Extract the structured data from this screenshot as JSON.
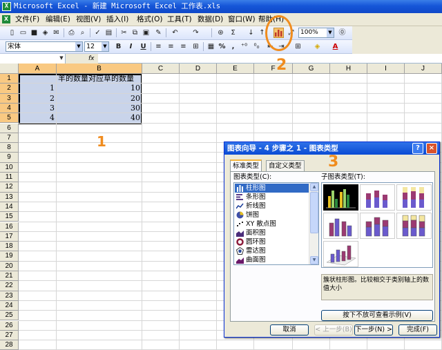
{
  "window": {
    "title": "Microsoft Excel - 新建 Microsoft Excel 工作表.xls",
    "app_icon": "excel-icon"
  },
  "menu": {
    "items": [
      "文件(F)",
      "编辑(E)",
      "视图(V)",
      "插入(I)",
      "格式(O)",
      "工具(T)",
      "数据(D)",
      "窗口(W)",
      "帮助(H)"
    ]
  },
  "toolbar": {
    "zoom": "100%",
    "chart_wizard_icon": "chart-wizard-icon"
  },
  "format_toolbar": {
    "font": "宋体",
    "size": "12",
    "bold": "B",
    "italic": "I",
    "underline": "U",
    "percent": "%",
    "comma": ","
  },
  "formula_bar": {
    "name_box": "",
    "fx": "fx",
    "content": ""
  },
  "sheet": {
    "columns": [
      "A",
      "B",
      "C",
      "D",
      "E",
      "F",
      "G",
      "H",
      "I",
      "J"
    ],
    "rows": [
      "1",
      "2",
      "3",
      "4",
      "5",
      "6",
      "7",
      "8",
      "9",
      "10",
      "11",
      "12",
      "13",
      "14",
      "15",
      "16",
      "17",
      "18",
      "19",
      "20",
      "21",
      "22",
      "23",
      "24",
      "25",
      "26",
      "27",
      "28"
    ],
    "B1": "羊的数量对应草的数量",
    "data": [
      [
        "1",
        "10"
      ],
      [
        "2",
        "20"
      ],
      [
        "3",
        "30"
      ],
      [
        "4",
        "40"
      ]
    ]
  },
  "dialog": {
    "title": "图表向导 - 4 步骤之 1 - 图表类型",
    "tabs": [
      "标准类型",
      "自定义类型"
    ],
    "chart_type_label": "图表类型(C):",
    "subtype_label": "子图表类型(T):",
    "chart_types": [
      "柱形图",
      "条形图",
      "折线图",
      "饼图",
      "XY 散点图",
      "面积图",
      "圆环图",
      "雷达图",
      "曲面图"
    ],
    "description": "簇状柱形图。比较相交于类别轴上的数值大小",
    "preview_button": "按下不放可查看示例(V)",
    "buttons": {
      "cancel": "取消",
      "back": "< 上一步(B)",
      "next": "下一步(N) >",
      "finish": "完成(F)"
    },
    "help": "?",
    "close": "×"
  },
  "annotations": {
    "a1": "1",
    "a2": "2",
    "a3": "3"
  },
  "colors": {
    "title_blue": "#0f48c8",
    "selection": "#c9d4ea",
    "annotation": "#f08c1e",
    "header_highlight": "#f9c982"
  }
}
